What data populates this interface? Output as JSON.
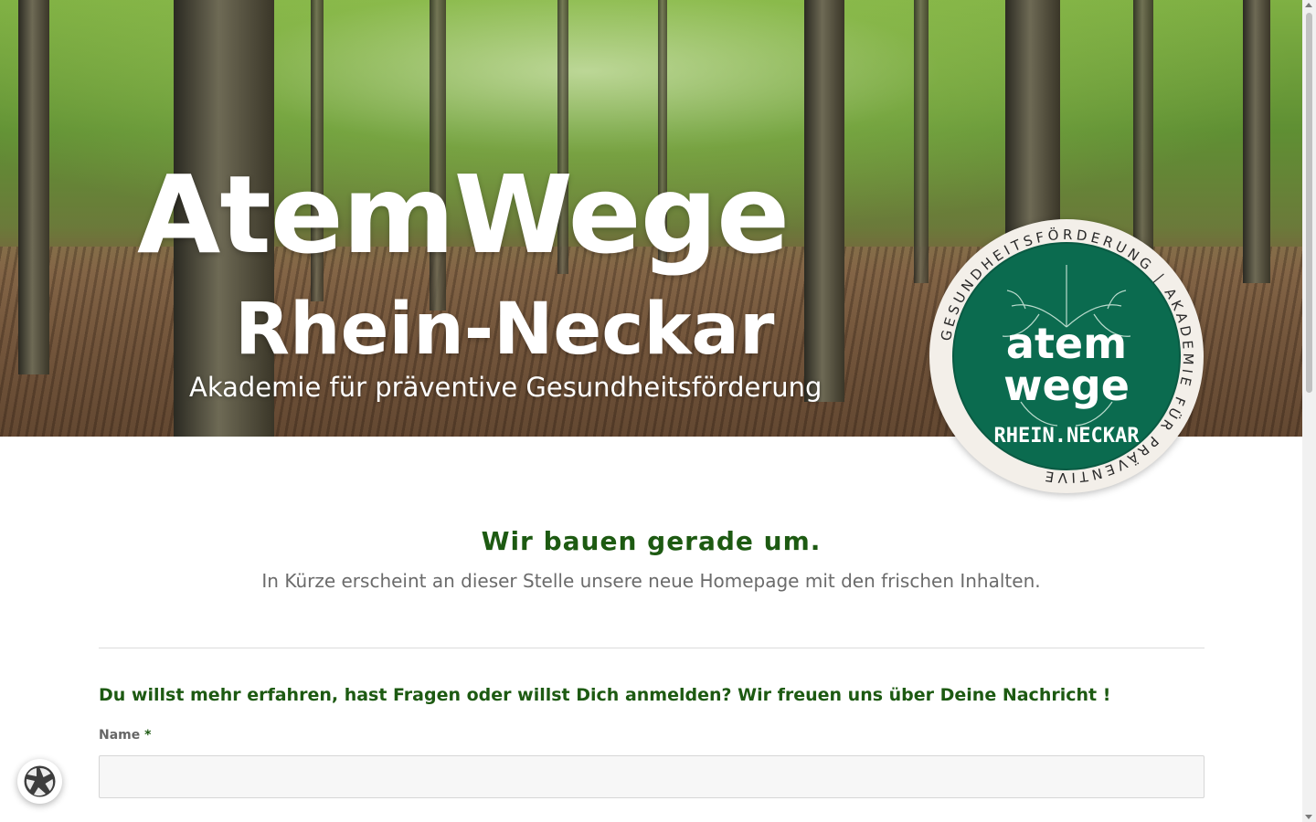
{
  "hero": {
    "title": "AtemWege",
    "subtitle": "Rhein-Neckar",
    "tagline": "Akademie für präventive Gesundheitsförderung"
  },
  "logo": {
    "word_top": "atem",
    "word_bottom": "wege",
    "region": "RHEIN.NECKAR",
    "ring_text": "GESUNDHEITSFÖRDERUNG | AKADEMIE FÜR PRÄVENTIVE",
    "colors": {
      "disc": "#0b6b4f",
      "ring": "#f3efe9",
      "accent": "#d9534f"
    }
  },
  "main": {
    "headline": "Wir bauen gerade um.",
    "lead": "In Kürze erscheint an dieser Stelle unsere neue Homepage mit den frischen Inhalten."
  },
  "form": {
    "intro": "Du willst mehr erfahren, hast Fragen oder willst Dich anmelden? Wir freuen uns über Deine Nachricht !",
    "name_label": "Name",
    "required_mark": "*",
    "name_value": ""
  },
  "widget": {
    "icon": "privacy-settings-icon"
  },
  "colors": {
    "brand_green": "#1d5a12",
    "text_gray": "#6b6b6b"
  }
}
